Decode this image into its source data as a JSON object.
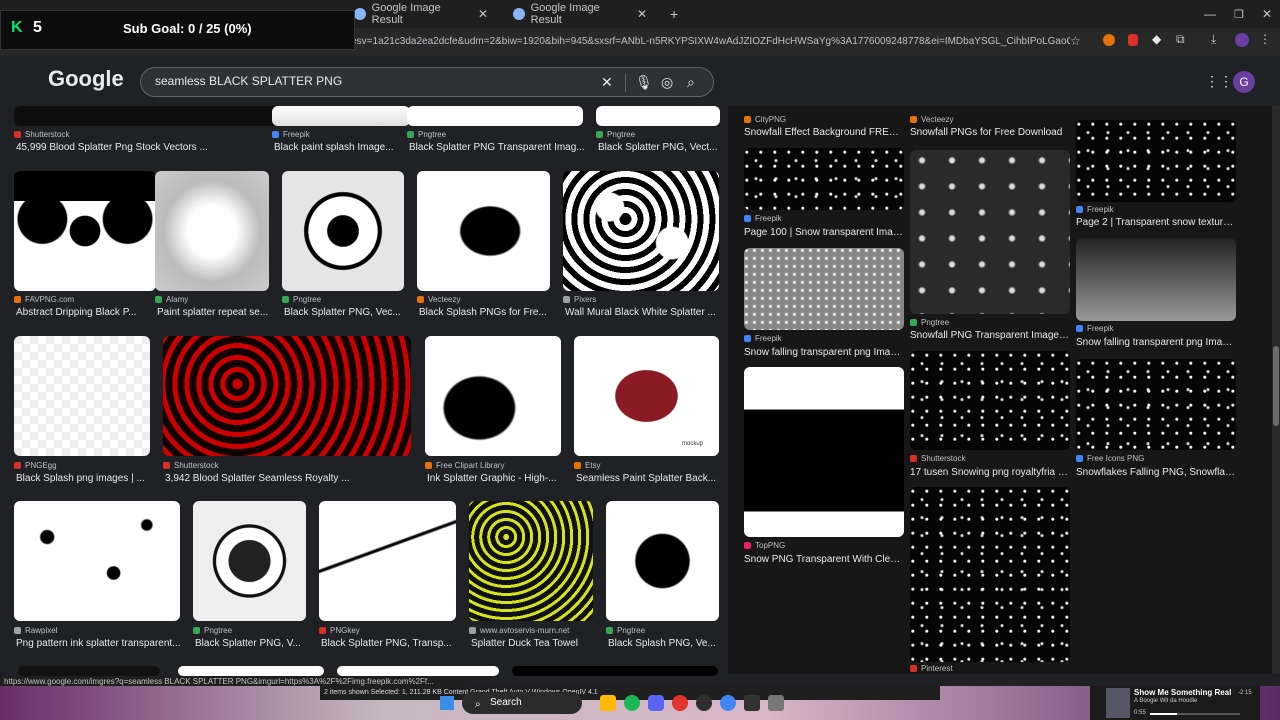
{
  "tabs": [
    {
      "title": "Google Image Result"
    },
    {
      "title": "Google Image Result"
    }
  ],
  "new_tab_label": "+",
  "address": {
    "url": "a_esv=1a21c3da2ea2dcfe&udm=2&biw=1920&bih=945&sxsrf=ANbL-n5RKYPSIXW4wAdJZIOZFdHcHWSaYg%3A1776009248778&ei=IMDbaYSGL_CihbIPoLGaoQo&ved..."
  },
  "overlay": {
    "k_letter": "K",
    "count": "5",
    "sub_goal": "Sub Goal: 0 / 25 (0%)"
  },
  "google": {
    "logo": "Google",
    "query": "seamless BLACK SPLATTER PNG",
    "avatar_letter": "G"
  },
  "left_results": [
    {
      "source": "Shutterstock",
      "title": "45,999 Blood Splatter Png Stock Vectors ...",
      "thumb": "top"
    },
    {
      "source": "Freepik",
      "title": "Black paint splash Image...",
      "thumb": "top"
    },
    {
      "source": "Pngtree",
      "title": "Black Splatter PNG Transparent Imag...",
      "thumb": "top"
    },
    {
      "source": "Pngtree",
      "title": "Black Splatter PNG, Vect...",
      "thumb": "top"
    },
    {
      "source": "FAVPNG.com",
      "title": "Abstract Dripping Black P..."
    },
    {
      "source": "Alamy",
      "title": "Paint splatter repeat se..."
    },
    {
      "source": "Pngtree",
      "title": "Black Splatter PNG, Vec..."
    },
    {
      "source": "Vecteezy",
      "title": "Black Splash PNGs for Fre..."
    },
    {
      "source": "Pixers",
      "title": "Wall Mural Black White Splatter ..."
    },
    {
      "source": "PNGEgg",
      "title": "Black Splash png images | ..."
    },
    {
      "source": "Shutterstock",
      "title": "3,942 Blood Splatter Seamless Royalty ..."
    },
    {
      "source": "Free Clipart Library",
      "title": "Ink Splatter Graphic - High-..."
    },
    {
      "source": "Etsy",
      "title": "Seamless Paint Splatter Back..."
    },
    {
      "source": "Rawpixel",
      "title": "Png pattern ink splatter transparent..."
    },
    {
      "source": "Pngtree",
      "title": "Black Splatter PNG, V..."
    },
    {
      "source": "PNGkey",
      "title": "Black Splatter PNG, Transp..."
    },
    {
      "source": "www.avtoservis-murn.net",
      "title": "Splatter Duck Tea Towel"
    },
    {
      "source": "Pngtree",
      "title": "Black Splash PNG, Ve..."
    }
  ],
  "right_results": [
    {
      "source": "CityPNG",
      "title": "Snowfall Effect Background FREE PNG | ..."
    },
    {
      "source": "Vecteezy",
      "title": "Snowfall PNGs for Free Download"
    },
    {
      "source": "Freepik",
      "title": "Page 100 | Snow transparent Images - ..."
    },
    {
      "source": "Freepik",
      "title": "Page 2 | Transparent snow texture Image..."
    },
    {
      "source": "Freepik",
      "title": "Snow falling transparent png Images - Fr..."
    },
    {
      "source": "Pngtree",
      "title": "Snowfall PNG Transparent Images Free..."
    },
    {
      "source": "Freepik",
      "title": "Snow falling transparent png Images - Fr..."
    },
    {
      "source": "Shutterstock",
      "title": "17 tusen Snowing png royaltyfria bilder,..."
    },
    {
      "source": "Free Icons PNG",
      "title": "Snowflakes Falling PNG, Snowflakes..."
    },
    {
      "source": "TopPNG",
      "title": "Snow PNG Transparent With Clear..."
    },
    {
      "source": "Pinterest",
      "title": ""
    }
  ],
  "mockup_label": "mockup",
  "status_url": "https://www.google.com/imgres?q=seamless BLACK SPLATTER PNG&imgurl=https%3A%2F%2Fimg.freepik.com%2Ff...",
  "explorer_bar": "2 items shown  Selected: 1,  211.28 KB      Content  Grand Theft Auto V  Windows  OpenIV 4.1",
  "taskbar": {
    "search": "Search"
  },
  "media": {
    "title": "Show Me Something Real",
    "artist": "A Boogie Wit da Hoodie",
    "elapsed": "0:55",
    "remaining": "-2:15",
    "progress": 0.3
  },
  "colors": {
    "bg": "#202124",
    "panel": "#171717",
    "text": "#e8eaed",
    "subtext": "#bdc1c6"
  }
}
